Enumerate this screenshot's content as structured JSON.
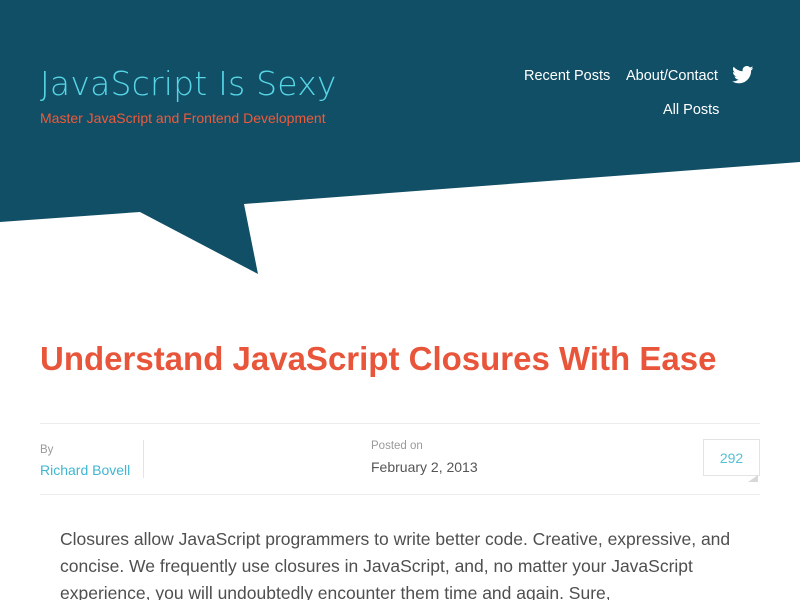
{
  "site": {
    "title": "JavaScript Is Sexy",
    "tagline": "Master JavaScript and Frontend Development"
  },
  "nav": {
    "items": [
      "Recent Posts",
      "About/Contact",
      "All Posts"
    ],
    "twitter_icon": "twitter-icon"
  },
  "post": {
    "title": "Understand JavaScript Closures With Ease",
    "by_label": "By",
    "author": "Richard Bovell",
    "posted_label": "Posted on",
    "date": "February 2, 2013",
    "comment_count": "292",
    "body": "Closures allow JavaScript programmers to write better code. Creative, expressive, and concise. We frequently use closures in JavaScript, and, no matter your JavaScript experience, you will undoubtedly encounter them time and again. Sure,"
  },
  "colors": {
    "header_bg": "#114f66",
    "site_title": "#57d6e6",
    "tagline": "#ee5a3a",
    "post_title": "#e8553a",
    "link": "#3fb6d1"
  }
}
